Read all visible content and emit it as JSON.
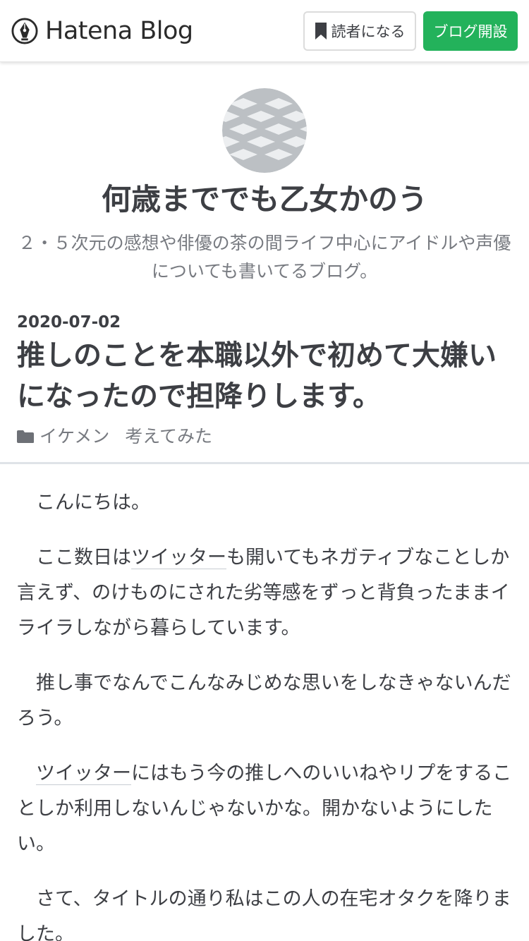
{
  "header": {
    "logo_text": "Hatena Blog",
    "reader_button_label": "読者になる",
    "open_blog_button_label": "ブログ開設"
  },
  "blog": {
    "title": "何歳まででも乙女かのう",
    "description": "２・５次元の感想や俳優の茶の間ライフ中心にアイドルや声優についても書いてるブログ。"
  },
  "entry": {
    "date": "2020-07-02",
    "title": "推しのことを本職以外で初めて大嫌いになったので担降りします。",
    "categories": [
      "イケメン",
      "考えてみた"
    ],
    "paragraphs": [
      {
        "text": "　こんにちは。"
      },
      {
        "before": "　ここ数日は",
        "link": "ツイッター",
        "after": "も開いてもネガティブなことしか言えず、のけものにされた劣等感をずっと背負ったままイライラしながら暮らしています。"
      },
      {
        "text": "　推し事でなんでこんなみじめな思いをしなきゃないんだろう。"
      },
      {
        "before": "　",
        "link": "ツイッター",
        "after": "にはもう今の推しへのいいねやリプをすることしか利用しないんじゃないかな。開かないようにしたい。"
      },
      {
        "text": "　さて、タイトルの通り私はこの人の在宅オタクを降りました。"
      }
    ]
  },
  "colors": {
    "accent_green": "#23b25b",
    "text": "#3d3f44",
    "muted": "#777a80"
  },
  "icons": [
    "hatena-logo-icon",
    "bookmark-icon",
    "folder-icon",
    "blog-avatar-pattern"
  ]
}
